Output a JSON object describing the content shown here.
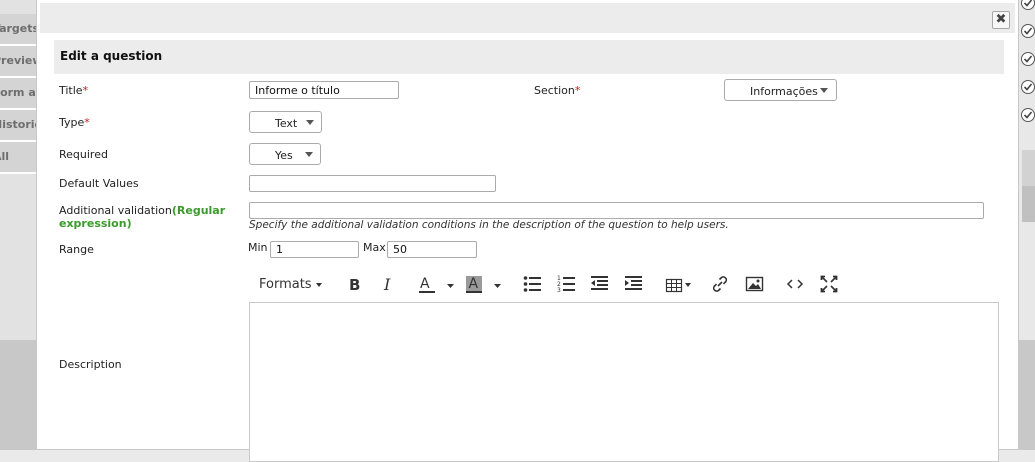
{
  "background": {
    "side_tabs": [
      "Targets",
      "Preview",
      "Form a",
      "Historic",
      "All"
    ]
  },
  "dialog": {
    "close_label": "✖",
    "header_title": "Edit a question",
    "fields": {
      "title_label": "Title",
      "title_value": "Informe o título",
      "section_label": "Section",
      "section_value": "Informações",
      "type_label": "Type",
      "type_value": "Text",
      "required_label": "Required",
      "required_value": "Yes",
      "default_values_label": "Default Values",
      "default_values_value": "",
      "additional_validation_label": "Additional validation",
      "regex_label": "(Regular expression)",
      "additional_validation_value": "",
      "validation_hint": "Specify the additional validation conditions in the description of the question to help users.",
      "range_label": "Range",
      "min_label": "Min",
      "min_value": "1",
      "max_label": "Max",
      "max_value": "50",
      "description_label": "Description",
      "required_marker": "*"
    },
    "editor_toolbar": {
      "formats_label": "Formats",
      "icons": [
        "bold-icon",
        "italic-icon",
        "text-color-icon",
        "background-color-icon",
        "bullet-list-icon",
        "numbered-list-icon",
        "outdent-icon",
        "indent-icon",
        "table-icon",
        "link-icon",
        "image-icon",
        "source-code-icon",
        "fullscreen-icon"
      ]
    }
  },
  "colors": {
    "required_asterisk": "#d4121e",
    "regex_hint": "#3a9a2b"
  }
}
